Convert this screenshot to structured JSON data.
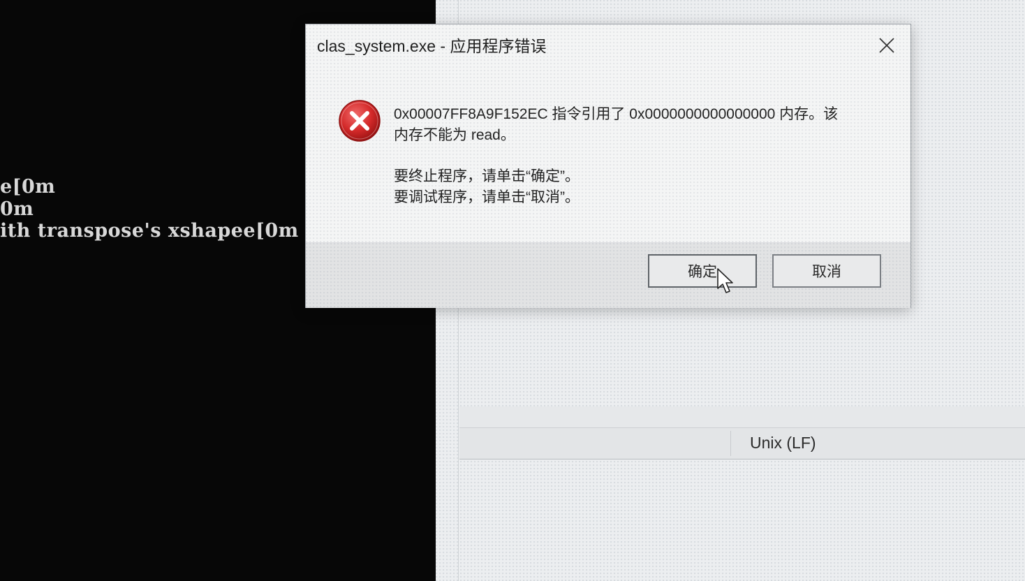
{
  "console": {
    "lines": [
      "e[0m",
      "0m",
      "ith transpose's xshapee[0m"
    ]
  },
  "editor": {
    "status_line_ending": "Unix (LF)"
  },
  "dialog": {
    "title": "clas_system.exe - 应用程序错误",
    "icon": "error-icon",
    "message_line1": "0x00007FF8A9F152EC 指令引用了 0x0000000000000000 内存。该",
    "message_line2": "内存不能为 read。",
    "instruction_line1": "要终止程序，请单击“确定”。",
    "instruction_line2": "要调试程序，请单击“取消”。",
    "ok_label": "确定",
    "cancel_label": "取消",
    "close_icon": "close-icon"
  },
  "colors": {
    "console_bg": "#070707",
    "error_red": "#d42a2a",
    "dialog_bg": "#f4f5f5"
  }
}
